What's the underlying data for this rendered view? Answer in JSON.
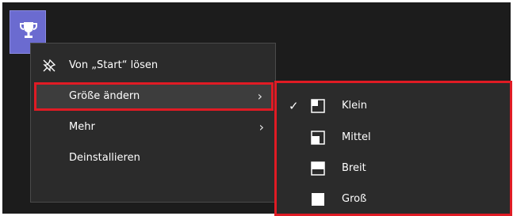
{
  "tile": {
    "icon": "trophy-icon"
  },
  "context_menu": {
    "items": [
      {
        "label": "Von „Start“ lösen",
        "icon": "unpin-icon"
      },
      {
        "label": "Größe ändern",
        "chevron": "›",
        "highlighted": true
      },
      {
        "label": "Mehr",
        "chevron": "›"
      },
      {
        "label": "Deinstallieren"
      }
    ]
  },
  "size_submenu": {
    "selected_mark": "✓",
    "items": [
      {
        "label": "Klein",
        "icon": "size-small-icon",
        "selected": true
      },
      {
        "label": "Mittel",
        "icon": "size-medium-icon"
      },
      {
        "label": "Breit",
        "icon": "size-wide-icon"
      },
      {
        "label": "Groß",
        "icon": "size-large-icon"
      }
    ]
  },
  "colors": {
    "highlight_border": "#e01b24",
    "menu_bg": "#2b2b2b",
    "tile_bg": "#6b6bd0"
  }
}
